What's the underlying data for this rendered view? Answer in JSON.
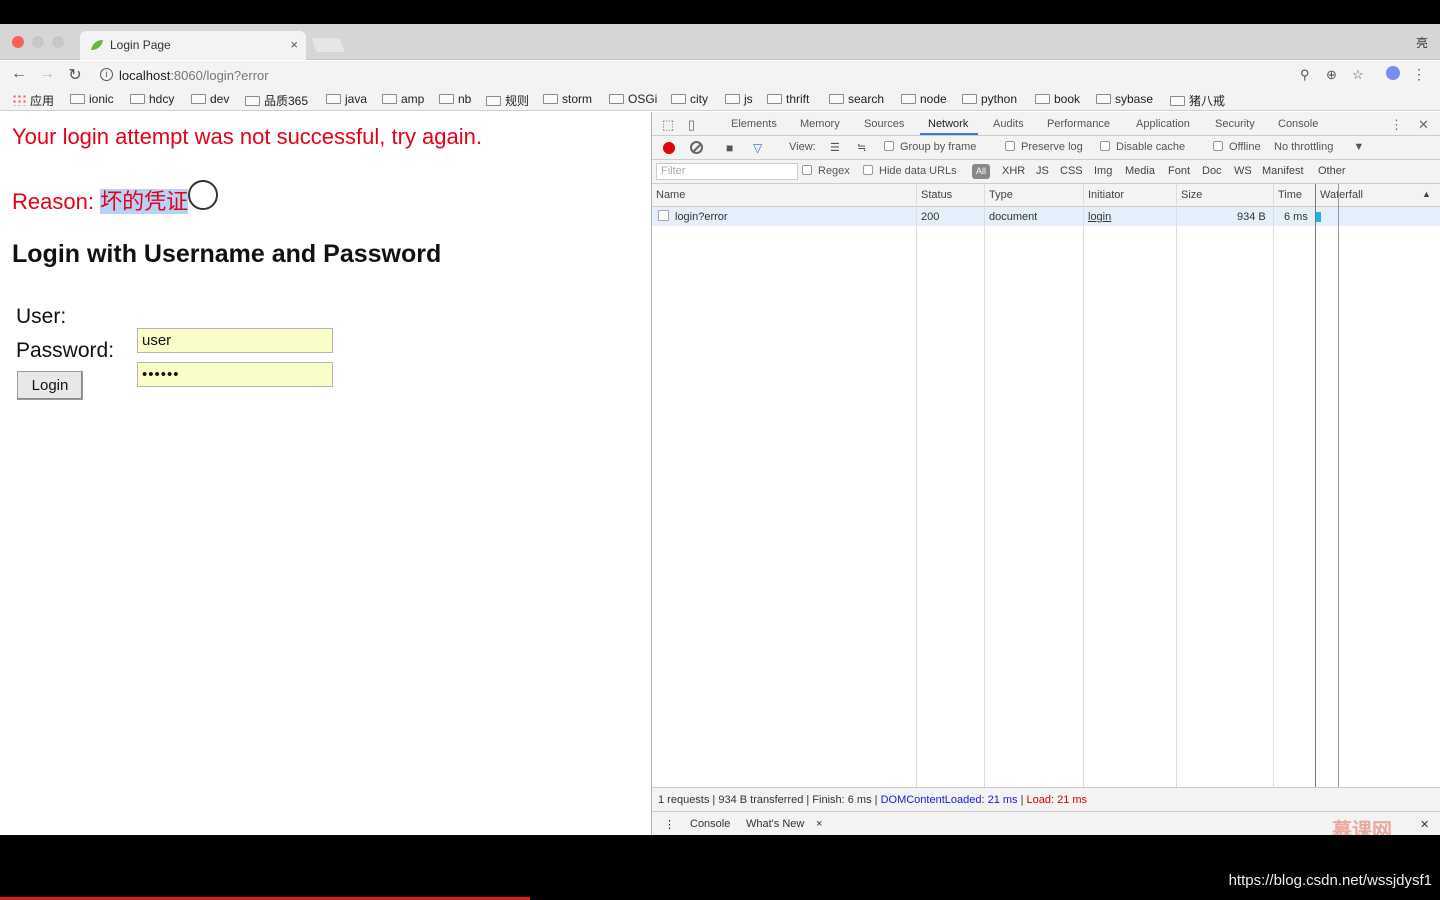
{
  "tab": {
    "title": "Login Page",
    "close": "×"
  },
  "profile_glyph": "亮",
  "toolbar": {
    "url_host": "localhost",
    "url_path": ":8060/login?error",
    "back": "←",
    "forward": "→",
    "reload": "↻",
    "info": "i",
    "menu": "⋮"
  },
  "bookmarks": [
    "应用",
    "ionic",
    "hdcy",
    "dev",
    "品质365",
    "java",
    "amp",
    "nb",
    "规则",
    "storm",
    "OSGi",
    "city",
    "js",
    "thrift",
    "search",
    "node",
    "python",
    "book",
    "sybase",
    "猪八戒"
  ],
  "page": {
    "error_message": "Your login attempt was not successful, try again.",
    "reason_label": "Reason: ",
    "reason_value": "坏的凭证",
    "heading": "Login with Username and Password",
    "user_label": "User:",
    "password_label": "Password:",
    "user_value": "user",
    "password_value": "••••••",
    "login_button": "Login"
  },
  "devtools": {
    "tabs": [
      "Elements",
      "Memory",
      "Sources",
      "Network",
      "Audits",
      "Performance",
      "Application",
      "Security",
      "Console"
    ],
    "active_tab": "Network",
    "toolbar": {
      "view": "View:",
      "group_by_frame": "Group by frame",
      "preserve_log": "Preserve log",
      "disable_cache": "Disable cache",
      "offline": "Offline",
      "throttling": "No throttling"
    },
    "filter": {
      "placeholder": "Filter",
      "regex": "Regex",
      "hide_data_urls": "Hide data URLs",
      "all": "All",
      "types": [
        "XHR",
        "JS",
        "CSS",
        "Img",
        "Media",
        "Font",
        "Doc",
        "WS",
        "Manifest",
        "Other"
      ]
    },
    "columns": [
      "Name",
      "Status",
      "Type",
      "Initiator",
      "Size",
      "Time",
      "Waterfall"
    ],
    "rows": [
      {
        "name": "login?error",
        "status": "200",
        "type": "document",
        "initiator": "login",
        "size": "934 B",
        "time": "6 ms"
      }
    ],
    "summary": {
      "main": "1 requests | 934 B transferred | Finish: 6 ms | ",
      "dom": "DOMContentLoaded: 21 ms",
      "sep": " | ",
      "load": "Load: 21 ms"
    },
    "drawer": {
      "console": "Console",
      "whats_new": "What's New",
      "close": "×"
    }
  },
  "watermark": "慕课网",
  "footer_url": "https://blog.csdn.net/wssjdysf1",
  "colors": {
    "error_red": "#e5001a",
    "autofill": "#fafdc8",
    "active_tab": "#3879d9",
    "record": "#e3000f"
  }
}
